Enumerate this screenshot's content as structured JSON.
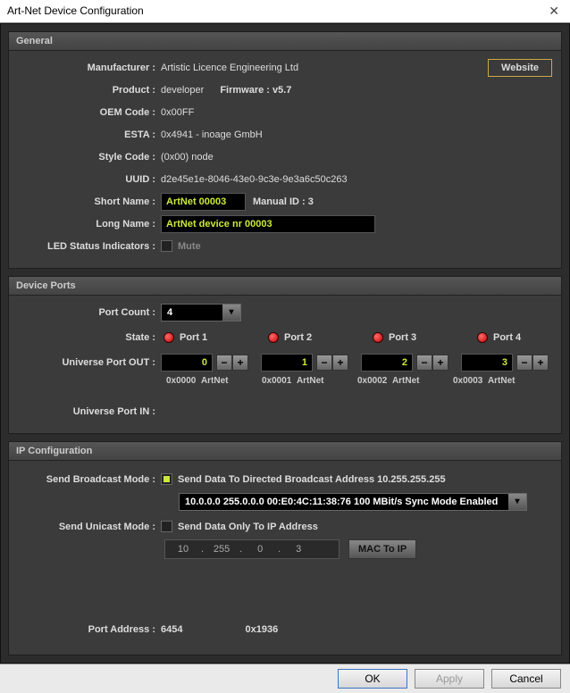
{
  "titlebar": {
    "title": "Art-Net Device Configuration"
  },
  "general": {
    "header": "General",
    "manufacturer_label": "Manufacturer :",
    "manufacturer": "Artistic Licence Engineering Ltd",
    "website_btn": "Website",
    "product_label": "Product :",
    "product": "developer",
    "firmware": "Firmware : v5.7",
    "oem_label": "OEM Code :",
    "oem": "0x00FF",
    "esta_label": "ESTA :",
    "esta": "0x4941 - inoage GmbH",
    "stylecode_label": "Style Code :",
    "stylecode": "(0x00) node",
    "uuid_label": "UUID :",
    "uuid": "d2e45e1e-8046-43e0-9c3e-9e3a6c50c263",
    "shortname_label": "Short Name :",
    "shortname_value": "ArtNet 00003",
    "manualid_label": "Manual ID : 3",
    "longname_label": "Long Name :",
    "longname_value": "ArtNet device nr 00003",
    "ledstatus_label": "LED Status Indicators :",
    "mute_label": "Mute"
  },
  "device_ports": {
    "header": "Device Ports",
    "portcount_label": "Port Count :",
    "portcount_value": "4",
    "state_label": "State :",
    "ports": [
      {
        "name": "Port 1",
        "value": "0",
        "hex": "0x0000",
        "type": "ArtNet"
      },
      {
        "name": "Port 2",
        "value": "1",
        "hex": "0x0001",
        "type": "ArtNet"
      },
      {
        "name": "Port 3",
        "value": "2",
        "hex": "0x0002",
        "type": "ArtNet"
      },
      {
        "name": "Port 4",
        "value": "3",
        "hex": "0x0003",
        "type": "ArtNet"
      }
    ],
    "univout_label": "Universe Port OUT :",
    "univin_label": "Universe Port IN :"
  },
  "ip": {
    "header": "IP Configuration",
    "broadcast_label": "Send Broadcast Mode :",
    "broadcast_text": "Send Data To Directed Broadcast Address 10.255.255.255",
    "interface_text": "10.0.0.0 255.0.0.0 00:E0:4C:11:38:76 100 MBit/s Sync Mode Enabled",
    "unicast_label": "Send Unicast Mode :",
    "unicast_text": "Send Data Only To IP Address",
    "ip_octets": [
      "10",
      "255",
      "0",
      "3"
    ],
    "mac_btn": "MAC To IP",
    "portaddr_label": "Port Address :",
    "portaddr_dec": "6454",
    "portaddr_hex": "0x1936"
  },
  "buttons": {
    "ok": "OK",
    "apply": "Apply",
    "cancel": "Cancel"
  }
}
